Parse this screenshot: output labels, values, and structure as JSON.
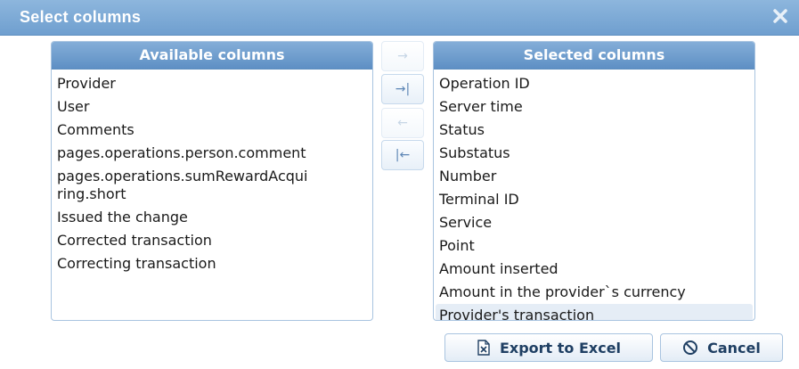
{
  "dialog": {
    "title": "Select columns",
    "close_icon": "close-icon"
  },
  "available": {
    "header": "Available columns",
    "items": [
      {
        "label": "Provider"
      },
      {
        "label": "User"
      },
      {
        "label": "Comments"
      },
      {
        "label": "pages.operations.person.comment"
      },
      {
        "label": "pages.operations.sumRewardAcqui"
      },
      {
        "label": "ring.short"
      },
      {
        "label": "Issued the change"
      },
      {
        "label": "Corrected transaction"
      },
      {
        "label": "Correcting transaction"
      }
    ]
  },
  "selected": {
    "header": "Selected columns",
    "items": [
      {
        "label": "Operation ID"
      },
      {
        "label": "Server time"
      },
      {
        "label": "Status"
      },
      {
        "label": "Substatus"
      },
      {
        "label": "Number"
      },
      {
        "label": "Terminal ID"
      },
      {
        "label": "Service"
      },
      {
        "label": "Point"
      },
      {
        "label": "Amount inserted"
      },
      {
        "label": "Amount in the provider`s currency"
      },
      {
        "label": "Provider's transaction"
      }
    ]
  },
  "move_buttons": {
    "move_right": {
      "glyph": "→",
      "icon": "arrow-right-icon",
      "enabled": false
    },
    "move_all_right": {
      "glyph": "→|",
      "icon": "arrow-right-bar-icon",
      "enabled": true
    },
    "move_left": {
      "glyph": "←",
      "icon": "arrow-left-icon",
      "enabled": false
    },
    "move_all_left": {
      "glyph": "|←",
      "icon": "arrow-left-bar-icon",
      "enabled": true
    }
  },
  "footer": {
    "export_label": "Export to Excel",
    "export_icon": "excel-icon",
    "cancel_label": "Cancel",
    "cancel_icon": "cancel-icon"
  },
  "colors": {
    "titlebar": "#7aa8d6",
    "header": "#6f9fcf",
    "border": "#a9c4e0",
    "button_text": "#1f3f63"
  }
}
